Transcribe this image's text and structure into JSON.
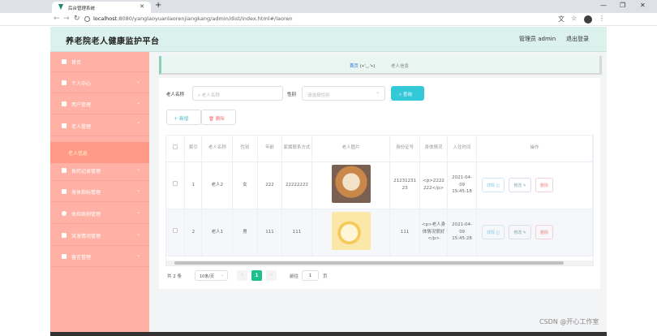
{
  "browser": {
    "tab_title": "后台管理系统",
    "url_host": "localhost",
    "url_path": ":8080/yanglaoyuanlaorenjiangkang/admin/dist/index.html#/laoren"
  },
  "header": {
    "title": "养老院老人健康监护平台",
    "admin": "管理员 admin",
    "logout": "退出登录"
  },
  "sidebar": {
    "items": [
      {
        "label": "首页",
        "icon": "home-icon"
      },
      {
        "label": "个人中心",
        "icon": "user-icon"
      },
      {
        "label": "用户管理",
        "icon": "folder-icon"
      },
      {
        "label": "老人管理",
        "icon": "grid-icon"
      },
      {
        "label": "食药记录管理",
        "icon": "folder-icon"
      },
      {
        "label": "身体指标管理",
        "icon": "chart-icon"
      },
      {
        "label": "体检病例管理",
        "icon": "clock-icon"
      },
      {
        "label": "突发情况管理",
        "icon": "send-icon"
      },
      {
        "label": "留言管理",
        "icon": "folder-icon"
      }
    ],
    "submenu_active": "老人信息"
  },
  "breadcrumb": {
    "home": "首页",
    "face": "(•'◡'•)",
    "current": "老人信息"
  },
  "filters": {
    "name_label": "老人名称",
    "name_placeholder": "老人名称",
    "gender_label": "性别",
    "gender_placeholder": "请选择性别",
    "search_button": "查询"
  },
  "actions": {
    "add": "新增",
    "delete": "删除"
  },
  "table": {
    "columns": [
      "索引",
      "老人名称",
      "性别",
      "年龄",
      "家属联系方式",
      "老人图片",
      "身份证号",
      "身体情况",
      "入住时间",
      "操作"
    ],
    "rows": [
      {
        "index": "1",
        "name": "老人2",
        "gender": "女",
        "age": "222",
        "contact": "22222222",
        "photo_icon": "dog-photo",
        "id_card": "2123123123",
        "condition": "<p>2222222</p>",
        "checkin": "2021-04-09 15:45:18"
      },
      {
        "index": "2",
        "name": "老人1",
        "gender": "男",
        "age": "111",
        "contact": "111",
        "photo_icon": "cartoon-photo",
        "id_card": "111",
        "condition": "<p>老人身体情况很好</p>",
        "checkin": "2021-04-09 15:45:28"
      }
    ],
    "op_detail": "详情",
    "op_edit": "修改",
    "op_delete": "删除"
  },
  "pagination": {
    "total": "共 2 条",
    "page_size": "10条/页",
    "current": "1",
    "goto_label": "前往",
    "goto_value": "1",
    "page_suffix": "页"
  },
  "watermark": "CSDN @开心工作室",
  "colors": {
    "sidebar": "#ffb1a5",
    "header": "#dbf1ec",
    "accent": "#33c9d8",
    "pager_active": "#1ec08e"
  }
}
